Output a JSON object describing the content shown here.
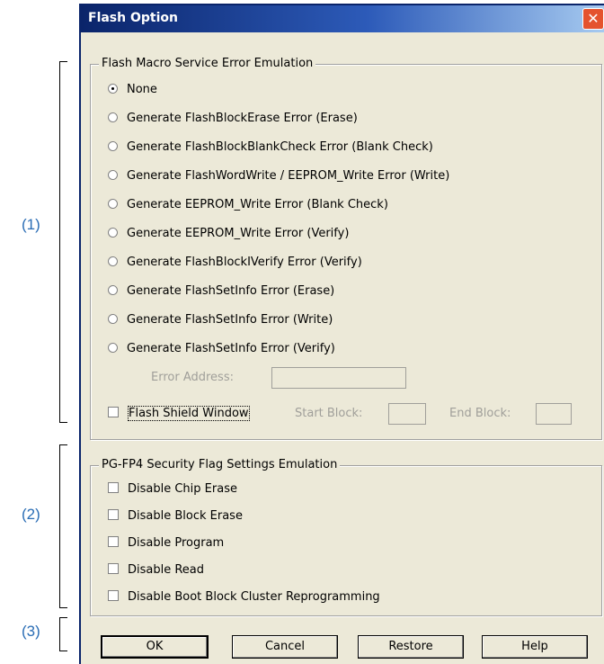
{
  "dialog": {
    "title": "Flash Option",
    "close_icon": "close-icon"
  },
  "callouts": {
    "c1": "(1)",
    "c2": "(2)",
    "c3": "(3)"
  },
  "group1": {
    "legend": "Flash Macro Service Error Emulation",
    "selected_index": 0,
    "options": [
      "None",
      "Generate FlashBlockErase Error (Erase)",
      "Generate FlashBlockBlankCheck Error (Blank Check)",
      "Generate FlashWordWrite / EEPROM_Write Error (Write)",
      "Generate EEPROM_Write Error (Blank Check)",
      "Generate EEPROM_Write Error (Verify)",
      "Generate FlashBlockIVerify Error (Verify)",
      "Generate FlashSetInfo Error (Erase)",
      "Generate FlashSetInfo Error (Write)",
      "Generate FlashSetInfo Error (Verify)"
    ],
    "error_address_label": "Error Address:",
    "error_address_value": "",
    "flash_shield_label": "Flash Shield Window",
    "start_block_label": "Start Block:",
    "start_block_value": "",
    "end_block_label": "End Block:",
    "end_block_value": ""
  },
  "group2": {
    "legend": "PG-FP4 Security Flag Settings Emulation",
    "options": [
      "Disable Chip Erase",
      "Disable Block Erase",
      "Disable Program",
      "Disable Read",
      "Disable Boot Block Cluster Reprogramming"
    ]
  },
  "buttons": {
    "ok": "OK",
    "cancel": "Cancel",
    "restore": "Restore",
    "help": "Help"
  }
}
